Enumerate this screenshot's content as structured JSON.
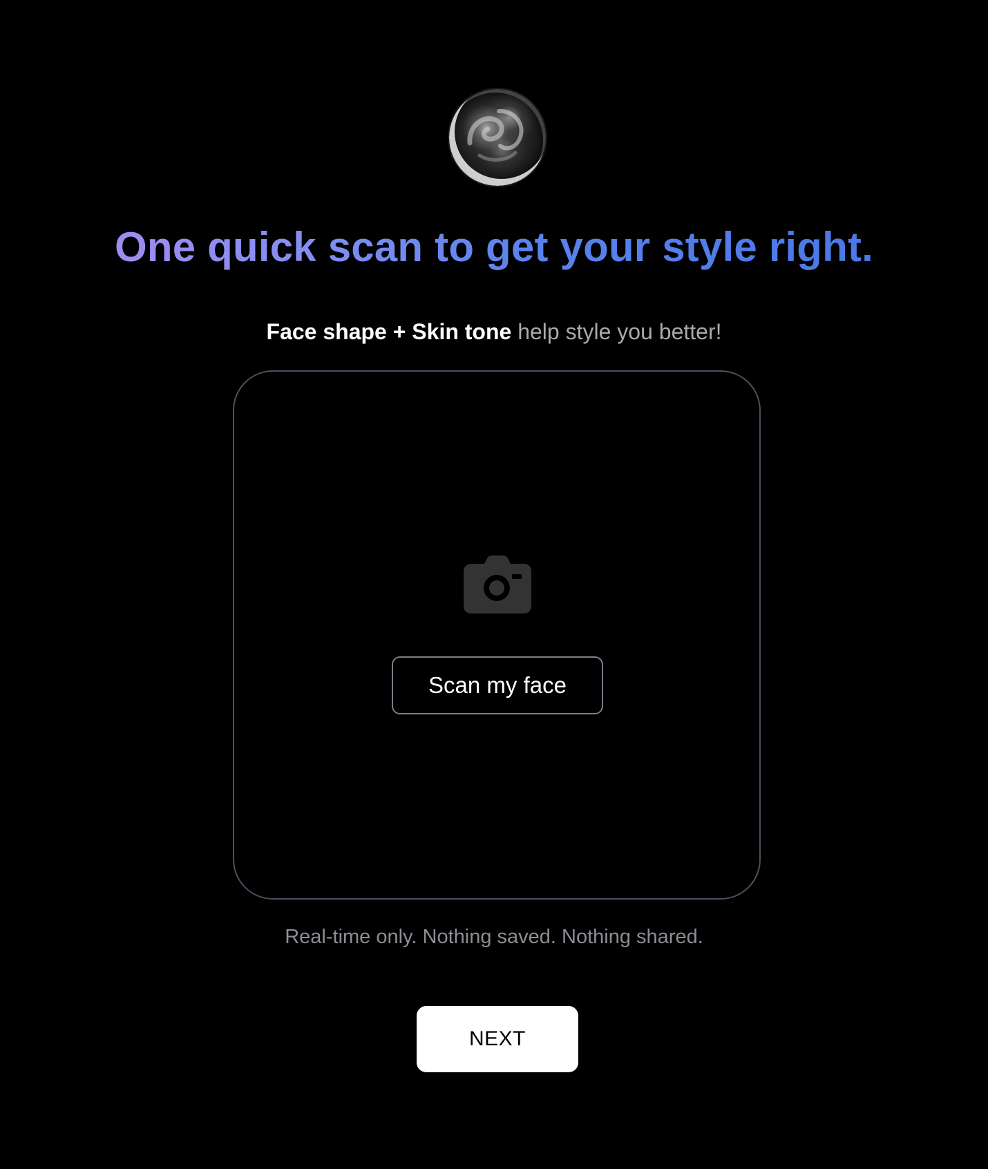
{
  "brand": {
    "logo_icon": "orb-logo-icon"
  },
  "headline": {
    "text": "One quick scan to get your style right.",
    "gradient_colors": [
      "#a18cf0",
      "#5a82ec",
      "#4a78e6"
    ]
  },
  "subline": {
    "bold_text": "Face shape + Skin tone",
    "regular_text": " help style you better!"
  },
  "scan_card": {
    "icon": "camera-icon",
    "button_label": "Scan my face",
    "border_color": "#4c5160"
  },
  "privacy_note": "Real-time only. Nothing saved. Nothing shared.",
  "footer": {
    "next_label": "NEXT"
  },
  "colors": {
    "background": "#000000",
    "primary_button_bg": "#ffffff",
    "muted_text": "#8d8e95"
  }
}
